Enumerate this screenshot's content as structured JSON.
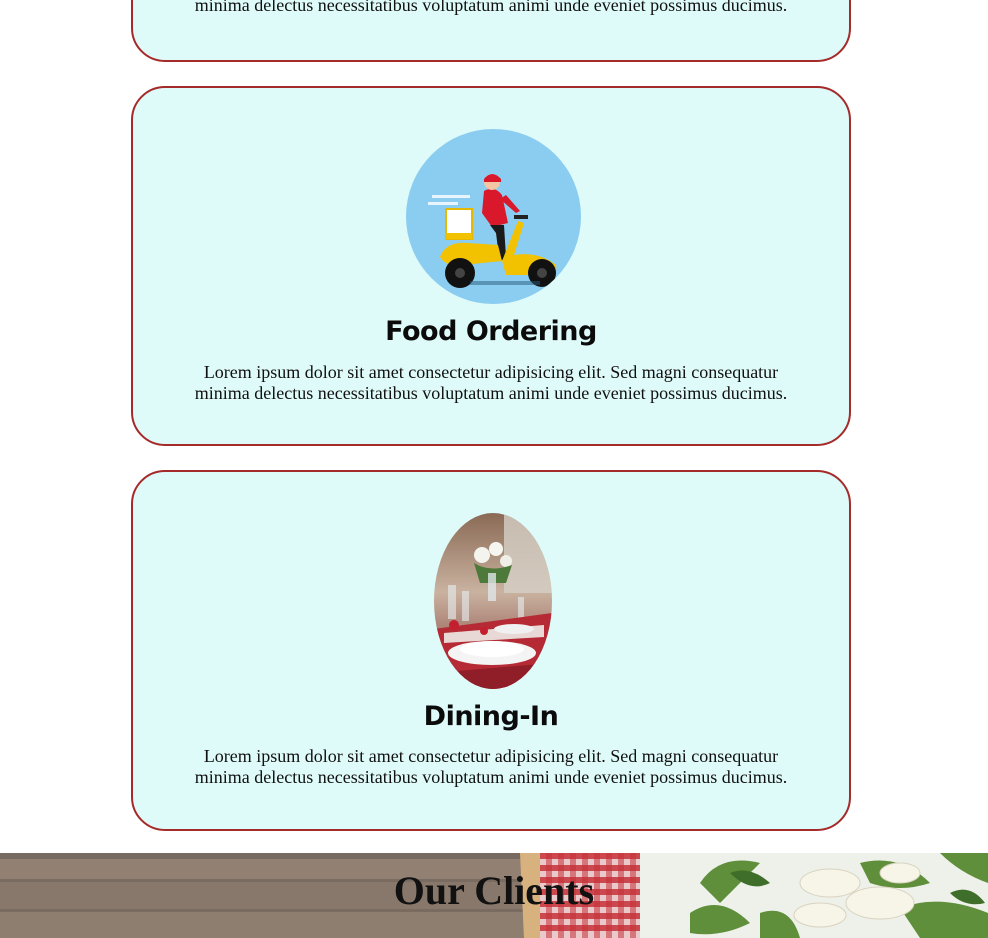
{
  "services": [
    {
      "description_line1": "",
      "description_line2": "minima delectus necessitatibus voluptatum animi unde eveniet possimus ducimus."
    },
    {
      "title": "Food Ordering",
      "description_line1": "Lorem ipsum dolor sit amet consectetur adipisicing elit. Sed magni consequatur",
      "description_line2": "minima delectus necessitatibus voluptatum animi unde eveniet possimus ducimus.",
      "image_icon": "delivery-scooter-illustration"
    },
    {
      "title": "Dining-In",
      "description_line1": "Lorem ipsum dolor sit amet consectetur adipisicing elit. Sed magni consequatur",
      "description_line2": "minima delectus necessitatibus voluptatum animi unde eveniet possimus ducimus.",
      "image_icon": "dining-table-photo"
    }
  ],
  "clients_section": {
    "title": "Our Clients"
  },
  "colors": {
    "card_background": "#defaf9",
    "card_border": "#a52a2a",
    "banner_wood": "#6e5b4b"
  }
}
